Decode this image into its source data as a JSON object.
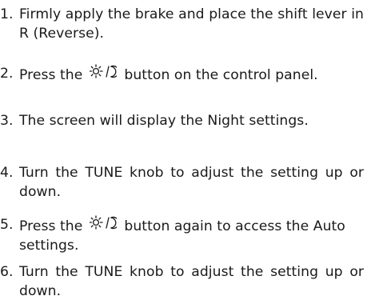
{
  "steps": [
    {
      "number": "1.",
      "text": "Firmly apply the brake and place the shift lever in R (Reverse)."
    },
    {
      "number": "2.",
      "before": "Press the",
      "icon": "sun-moon-icon",
      "after": "button on the control panel."
    },
    {
      "number": "3.",
      "text": "The screen will display the Night settings."
    },
    {
      "number": "4.",
      "text": "Turn the TUNE knob to adjust the setting up or down."
    },
    {
      "number": "5.",
      "before": "Press the",
      "icon": "sun-moon-icon",
      "after": "button again to access the Auto settings."
    },
    {
      "number": "6.",
      "text": "Turn the TUNE knob to adjust the setting up or down."
    }
  ]
}
